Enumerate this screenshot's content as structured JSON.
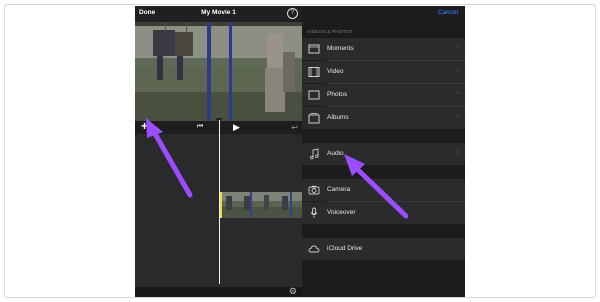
{
  "editor": {
    "done_label": "Done",
    "title": "My Movie 1",
    "help_glyph": "?",
    "add_glyph": "+",
    "skip_back_glyph": "⏮",
    "play_glyph": "▶",
    "undo_glyph": "↩",
    "settings_glyph": "⚙"
  },
  "menu": {
    "cancel_label": "Cancel",
    "section_title": "VIDEOS & PHOTOS",
    "items": [
      {
        "label": "Moments",
        "icon": "moments-icon"
      },
      {
        "label": "Video",
        "icon": "film-icon"
      },
      {
        "label": "Photos",
        "icon": "photo-icon"
      },
      {
        "label": "Albums",
        "icon": "albums-icon"
      },
      {
        "label": "Audio",
        "icon": "music-note-icon"
      },
      {
        "label": "Camera",
        "icon": "camera-icon"
      },
      {
        "label": "Voiceover",
        "icon": "microphone-icon"
      },
      {
        "label": "iCloud Drive",
        "icon": "cloud-icon"
      }
    ],
    "chevron": "›"
  },
  "colors": {
    "accent_link": "#3d8bff",
    "annotation_arrow": "#9b4dff"
  }
}
